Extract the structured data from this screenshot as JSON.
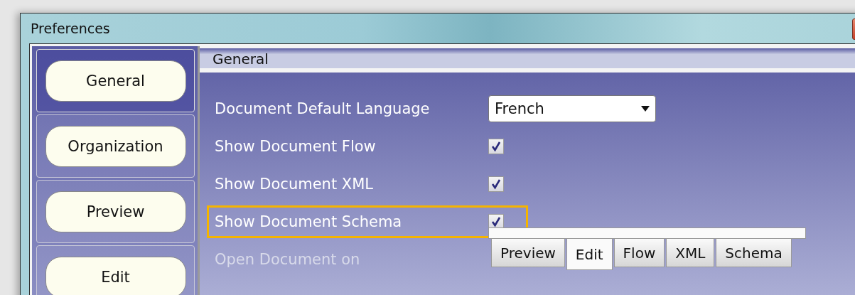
{
  "window": {
    "title": "Preferences"
  },
  "sidebar": {
    "items": [
      {
        "label": "General",
        "selected": true
      },
      {
        "label": "Organization",
        "selected": false
      },
      {
        "label": "Preview",
        "selected": false
      },
      {
        "label": "Edit",
        "selected": false
      }
    ]
  },
  "section": {
    "title": "General"
  },
  "settings": [
    {
      "kind": "dropdown",
      "label": "Document Default Language",
      "value": "French",
      "highlighted": false
    },
    {
      "kind": "checkbox",
      "label": "Show Document Flow",
      "checked": true,
      "highlighted": false
    },
    {
      "kind": "checkbox",
      "label": "Show Document XML",
      "checked": true,
      "highlighted": false
    },
    {
      "kind": "checkbox",
      "label": "Show Document Schema",
      "checked": true,
      "highlighted": true
    },
    {
      "kind": "tabs",
      "label": "Open Document on",
      "tabs": [
        {
          "label": "Preview",
          "selected": false
        },
        {
          "label": "Edit",
          "selected": true
        },
        {
          "label": "Flow",
          "selected": false
        },
        {
          "label": "XML",
          "selected": false
        },
        {
          "label": "Schema",
          "selected": false
        }
      ],
      "highlighted": false
    }
  ]
}
